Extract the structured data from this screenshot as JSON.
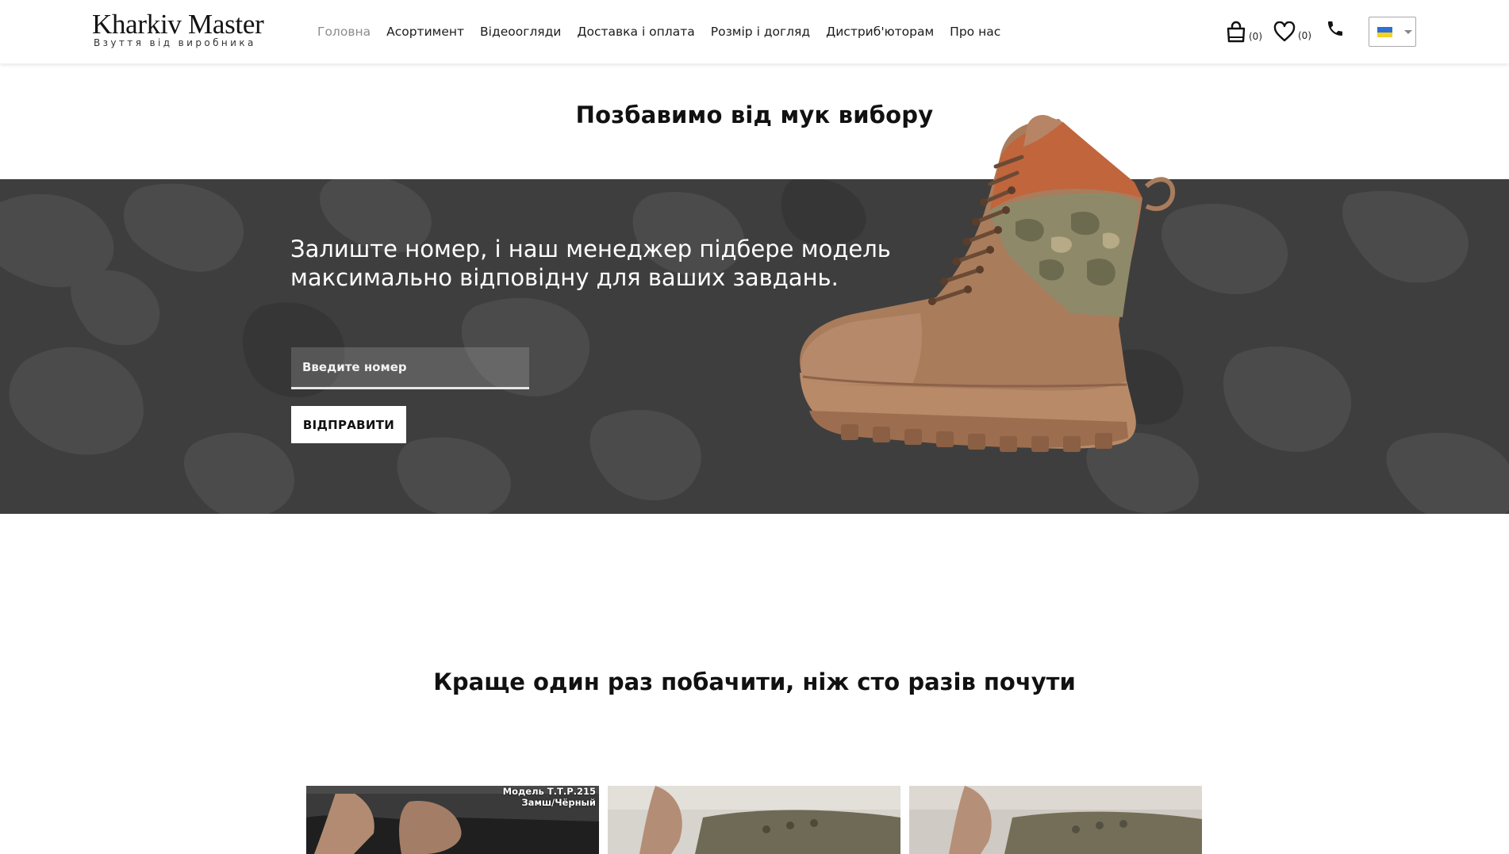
{
  "header": {
    "logo_title": "Kharkiv Master",
    "logo_subtitle": "Взуття від виробника",
    "nav": [
      {
        "label": "Головна",
        "active": true
      },
      {
        "label": "Асортимент"
      },
      {
        "label": "Відеоогляди"
      },
      {
        "label": "Доставка і оплата"
      },
      {
        "label": "Розмір і догляд"
      },
      {
        "label": "Дистриб'юторам"
      },
      {
        "label": "Про нас"
      }
    ],
    "cart_count": "(0)",
    "wishlist_count": "(0)",
    "icons": [
      "cart-icon",
      "heart-icon",
      "phone-icon",
      "ukraine-flag-icon",
      "chevron-down-icon"
    ]
  },
  "hero": {
    "title": "Позбавимо від мук вибору",
    "text": "Залиште номер, і наш менеджер підбере модель максимально відповідну для ваших завдань.",
    "phone_placeholder": "Введите номер",
    "phone_value": "",
    "submit_label": "ВІДПРАВИТИ"
  },
  "videos_section": {
    "title": "Краще один раз побачити, ніж сто разів почути",
    "videos": [
      {
        "caption_line1": "Модель Т.Т.Р.215",
        "caption_line2": "Замш/Чёрный"
      },
      {
        "caption_line1": "",
        "caption_line2": ""
      },
      {
        "caption_line1": "",
        "caption_line2": ""
      }
    ]
  },
  "colors": {
    "band": "#3e3e3e",
    "nav_active": "#8c8c8c",
    "flag_blue": "#2e6fd8",
    "flag_yellow": "#f3d224"
  }
}
